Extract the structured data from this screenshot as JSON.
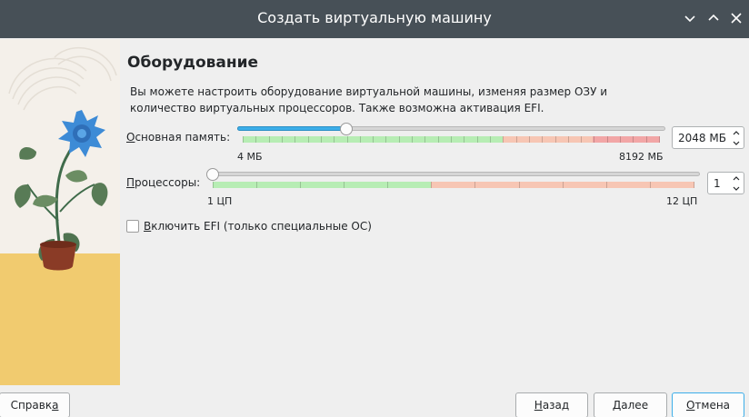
{
  "window": {
    "title": "Создать виртуальную машину"
  },
  "page": {
    "heading": "Оборудование",
    "description": "Вы можете настроить оборудование виртуальной машины, изменяя размер ОЗУ и количество виртуальных процессоров. Также возможна активация EFI."
  },
  "memory": {
    "label_mnemonic": "О",
    "label_rest": "сновная память:",
    "min_label": "4 МБ",
    "max_label": "8192 МБ",
    "value": "2048 МБ",
    "position_fraction": 0.25
  },
  "cpu": {
    "label_mnemonic": "П",
    "label_rest": "роцессоры:",
    "min_label": "1 ЦП",
    "max_label": "12 ЦП",
    "value": "1",
    "position_fraction": 0.0
  },
  "efi": {
    "label_mnemonic": "В",
    "label_rest": "ключить EFI (только специальные ОС)",
    "checked": false
  },
  "buttons": {
    "help": {
      "before": "Справк",
      "mnemonic": "а",
      "after": ""
    },
    "back": {
      "before": "",
      "mnemonic": "Н",
      "after": "азад"
    },
    "next": {
      "before": "",
      "mnemonic": "Д",
      "after": "алее"
    },
    "cancel": {
      "before": "",
      "mnemonic": "О",
      "after": "тмена"
    }
  },
  "colors": {
    "titlebar": "#475057",
    "accent": "#3daee9",
    "scale_green": "#b7edb4",
    "scale_orange": "#f7c6b4",
    "scale_red": "#f2a6a6"
  },
  "icons": [
    "chevron-down-icon",
    "chevron-up-icon",
    "close-icon",
    "spin-up-icon",
    "spin-down-icon"
  ]
}
